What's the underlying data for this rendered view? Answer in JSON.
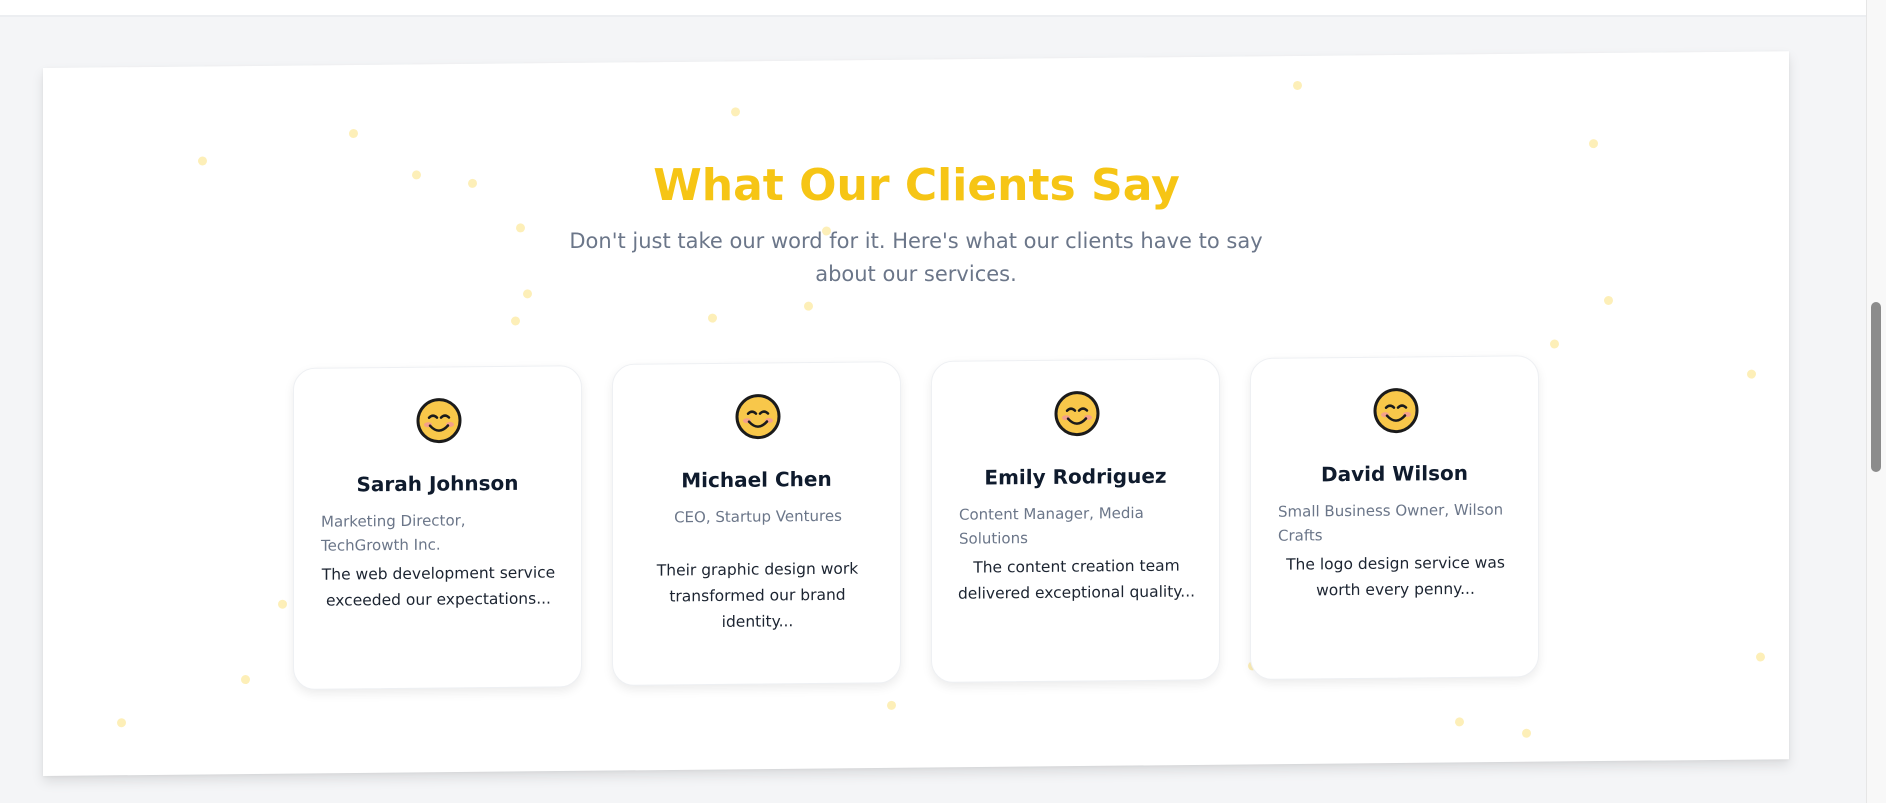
{
  "section": {
    "title": "What Our Clients Say",
    "subtitle": "Don't just take our word for it. Here's what our clients have to say about our services."
  },
  "testimonials": [
    {
      "avatar_icon": "smiling-face-icon",
      "name": "Sarah Johnson",
      "role": "Marketing Director, TechGrowth Inc.",
      "quote": "The web development service exceeded our expectations..."
    },
    {
      "avatar_icon": "smiling-face-icon",
      "name": "Michael Chen",
      "role": "CEO, Startup Ventures",
      "quote": "Their graphic design work transformed our brand identity..."
    },
    {
      "avatar_icon": "smiling-face-icon",
      "name": "Emily Rodriguez",
      "role": "Content Manager, Media Solutions",
      "quote": "The content creation team delivered exceptional quality..."
    },
    {
      "avatar_icon": "smiling-face-icon",
      "name": "David Wilson",
      "role": "Small Business Owner, Wilson Crafts",
      "quote": "The logo design service was worth every penny..."
    }
  ],
  "colors": {
    "title": "#f6c515",
    "subtitle": "#6b7689",
    "name": "#0f1b2d",
    "decor_dots": "#fdecab"
  }
}
